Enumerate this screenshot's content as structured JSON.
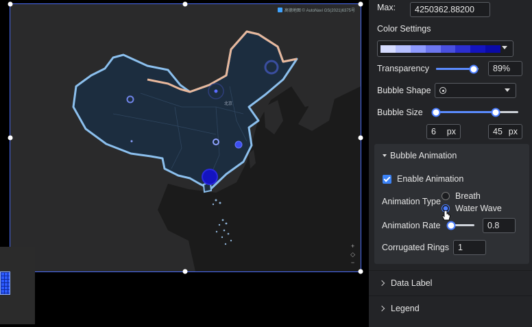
{
  "map": {
    "attribution": "高德地图 © AutoNavi GS(2021)6375号",
    "city_label": "北京",
    "zoom_in": "+",
    "locate": "◇",
    "zoom_out": "−"
  },
  "panel": {
    "max_label": "Max:",
    "max_value": "4250362.88200",
    "color_settings_label": "Color Settings",
    "color_ramp": [
      "#d6dcff",
      "#b5bfff",
      "#8f9bff",
      "#6d77f0",
      "#4a50e0",
      "#2c2ed0",
      "#1414c0",
      "#0a0aa8"
    ],
    "transparency_label": "Transparency",
    "transparency_value": "89%",
    "transparency_fraction": 0.89,
    "bubble_shape_label": "Bubble Shape",
    "bubble_shape_icon": "target-circle-icon",
    "bubble_size_label": "Bubble Size",
    "bubble_size_min": "6",
    "bubble_size_max": "45",
    "unit": "px",
    "animation": {
      "section_title": "Bubble Animation",
      "enable_label": "Enable Animation",
      "enabled": true,
      "type_label": "Animation Type",
      "type_options": [
        "Breath",
        "Water Wave"
      ],
      "selected_type": "Water Wave",
      "rate_label": "Animation Rate",
      "rate_value": "0.8",
      "rings_label": "Corrugated Rings",
      "rings_value": "1"
    },
    "data_label_title": "Data Label",
    "legend_title": "Legend"
  }
}
